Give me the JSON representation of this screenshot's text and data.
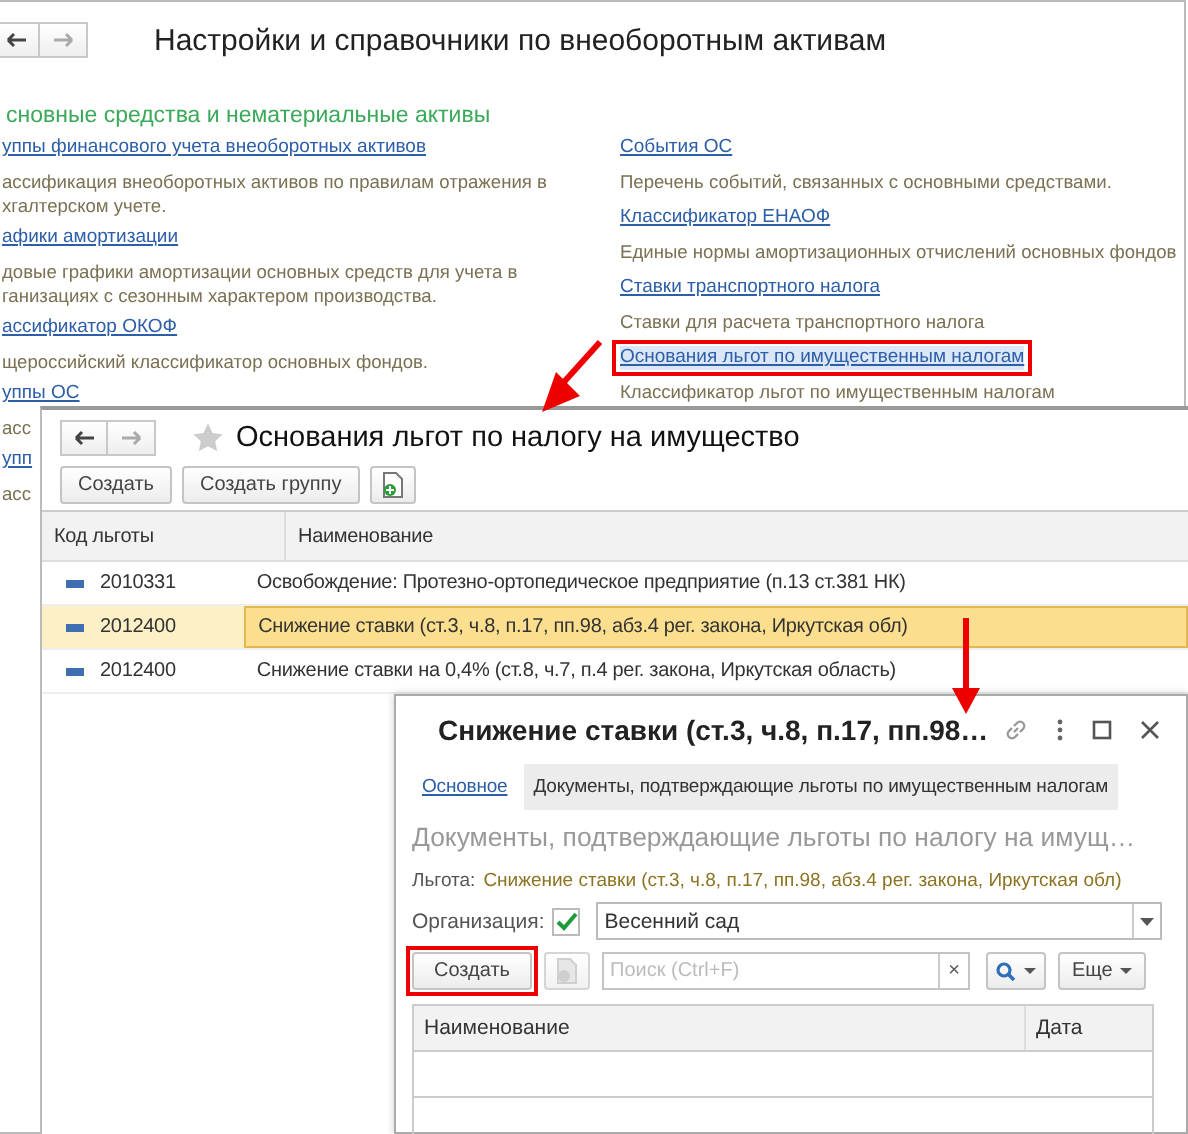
{
  "background_window": {
    "title": "Настройки и справочники по внеоборотным активам",
    "section_heading": "сновные средства и нематериальные активы",
    "left_column": [
      {
        "link": "уппы финансового учета внеоборотных активов",
        "description": [
          "ассификация внеоборотных активов по правилам отражения в",
          "хгалтерском учете."
        ]
      },
      {
        "link": "афики амортизации",
        "description": [
          "довые графики амортизации основных средств для учета в",
          "ганизациях с сезонным характером производства."
        ]
      },
      {
        "link": "ассификатор ОКОФ",
        "description": [
          "щероссийский классификатор основных фондов."
        ]
      },
      {
        "link": "уппы ОС",
        "description": [
          "асс"
        ]
      },
      {
        "link": "упп",
        "description": [
          "асс"
        ]
      }
    ],
    "right_column": [
      {
        "link": "События ОС",
        "description": "Перечень событий, связанных с основными средствами.",
        "highlighted": false
      },
      {
        "link": "Классификатор ЕНАОФ",
        "description": "Единые нормы амортизационных отчислений основных фондов",
        "highlighted": false
      },
      {
        "link": "Ставки транспортного налога",
        "description": "Ставки для расчета транспортного налога",
        "highlighted": false
      },
      {
        "link": "Основания льгот по имущественным налогам",
        "description": "Классификатор льгот по имущественным налогам",
        "highlighted": true
      }
    ]
  },
  "list_window": {
    "title": "Основания льгот по налогу на имущество",
    "buttons": [
      "Создать",
      "Создать группу"
    ],
    "table": {
      "columns": [
        "Код льготы",
        "Наименование"
      ],
      "rows": [
        {
          "code": "2010331",
          "name": "Освобождение: Протезно-ортопедическое предприятие (п.13 ст.381 НК)",
          "selected": false
        },
        {
          "code": "2012400",
          "name": "Снижение ставки (ст.3, ч.8, п.17, пп.98, абз.4 рег. закона, Иркутская обл)",
          "selected": true
        },
        {
          "code": "2012400",
          "name": "Снижение ставки на 0,4% (ст.8, ч.7, п.4 рег. закона, Иркутская область)",
          "selected": false
        }
      ]
    }
  },
  "item_window": {
    "title": "Снижение ставки (ст.3, ч.8, п.17, пп.98…",
    "tabs": [
      {
        "label": "Основное",
        "selected": false
      },
      {
        "label": "Документы, подтверждающие льготы по имущественным налогам",
        "selected": true
      }
    ],
    "heading": "Документы, подтверждающие льготы по налогу на имущ…",
    "benefit": {
      "label": "Льгота:",
      "value": "Снижение ставки (ст.3, ч.8, п.17, пп.98, абз.4 рег. закона, Иркутская обл)"
    },
    "organization": {
      "label": "Организация:",
      "checked": true,
      "value": "Весенний сад"
    },
    "create_button": {
      "label": "Создать",
      "highlighted": true
    },
    "search": {
      "placeholder": "Поиск (Ctrl+F)",
      "clear": "×"
    },
    "more_button": "Еще",
    "table": {
      "columns": [
        "Наименование",
        "Дата"
      ]
    }
  }
}
